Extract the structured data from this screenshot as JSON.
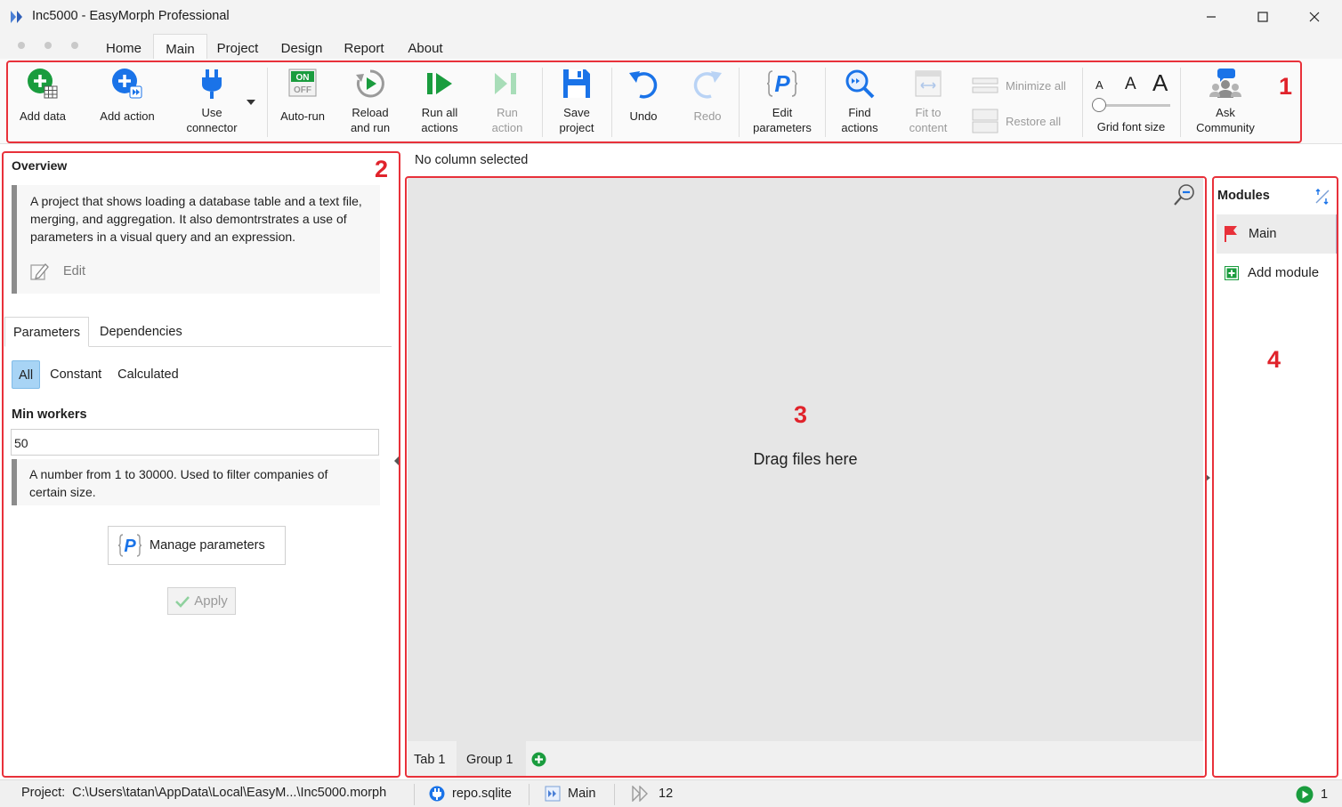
{
  "window": {
    "title": "Inc5000 - EasyMorph Professional",
    "minimize": "—",
    "maximize": "☐",
    "close": "✕"
  },
  "menu": [
    "Home",
    "Main",
    "Project",
    "Design",
    "Report",
    "About"
  ],
  "menu_active": "Main",
  "ribbon": {
    "add_data": "Add data",
    "add_action": "Add action",
    "use_connector_1": "Use",
    "use_connector_2": "connector",
    "auto_run": "Auto-run",
    "auto_run_on": "ON",
    "auto_run_off": "OFF",
    "reload_1": "Reload",
    "reload_2": "and run",
    "run_all_1": "Run all",
    "run_all_2": "actions",
    "run_action_1": "Run",
    "run_action_2": "action",
    "save_1": "Save",
    "save_2": "project",
    "undo": "Undo",
    "redo": "Redo",
    "edit_params_1": "Edit",
    "edit_params_2": "parameters",
    "find_1": "Find",
    "find_2": "actions",
    "fit_1": "Fit to",
    "fit_2": "content",
    "minimize_all": "Minimize all",
    "restore_all": "Restore all",
    "font_a": "A",
    "grid_font_size": "Grid font size",
    "ask_1": "Ask",
    "ask_2": "Community"
  },
  "annotations": {
    "n1": "1",
    "n2": "2",
    "n3": "3",
    "n4": "4"
  },
  "overview": {
    "title": "Overview",
    "text": "A project that shows loading a database table and a text file, merging, and aggregation. It also demontrstrates a use of parameters in a visual query and an expression.",
    "edit": "Edit"
  },
  "left_tabs": [
    "Parameters",
    "Dependencies"
  ],
  "filters": [
    "All",
    "Constant",
    "Calculated"
  ],
  "parameter": {
    "label": "Min workers",
    "value": "50",
    "description": "A number from 1 to 30000. Used to filter companies of certain size."
  },
  "manage_parameters": "Manage parameters",
  "apply": "Apply",
  "canvas": {
    "column_status": "No column selected",
    "drag_text": "Drag files here",
    "tabs": [
      "Tab 1",
      "Group 1"
    ]
  },
  "modules": {
    "title": "Modules",
    "items": [
      "Main"
    ],
    "add": "Add module"
  },
  "statusbar": {
    "project_label": "Project:",
    "project_path": "C:\\Users\\tatan\\AppData\\Local\\EasyM...\\Inc5000.morph",
    "repo": "repo.sqlite",
    "module": "Main",
    "actions_count": "12",
    "running_count": "1"
  },
  "colors": {
    "accent_blue": "#1a73e8",
    "accent_green": "#1a9c3e",
    "annotation_red": "#e8313a"
  }
}
